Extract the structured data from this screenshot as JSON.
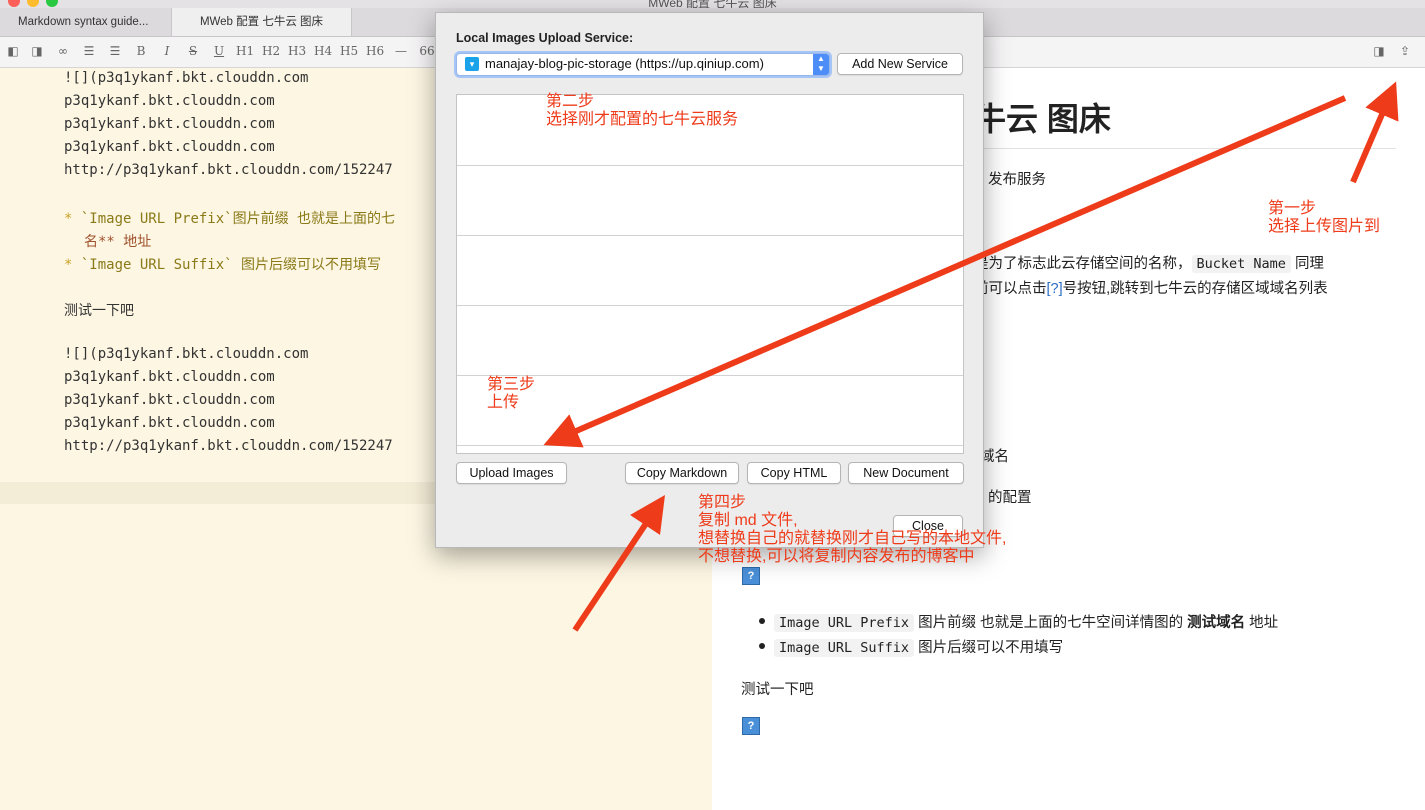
{
  "window": {
    "title": "MWeb 配置 七牛云 图床"
  },
  "tabs": [
    {
      "label": "Markdown syntax guide..."
    },
    {
      "label": "MWeb 配置 七牛云 图床"
    }
  ],
  "toolbar": {
    "items": [
      "B",
      "I",
      "S",
      "U",
      "H1",
      "H2",
      "H3",
      "H4",
      "H5",
      "H6",
      "—",
      "66"
    ]
  },
  "editor": {
    "lines": [
      "![](p3q1ykanf.bkt.clouddn.com",
      "p3q1ykanf.bkt.clouddn.com",
      "p3q1ykanf.bkt.clouddn.com",
      "p3q1ykanf.bkt.clouddn.com",
      "http://p3q1ykanf.bkt.clouddn.com/152247",
      "`Image URL Prefix`图片前缀 也就是上面的七",
      "名** 地址",
      "`Image URL Suffix` 图片后缀可以不用填写",
      "测试一下吧",
      "![](p3q1ykanf.bkt.clouddn.com",
      "p3q1ykanf.bkt.clouddn.com",
      "p3q1ykanf.bkt.clouddn.com",
      "p3q1ykanf.bkt.clouddn.com",
      "http://p3q1ykanf.bkt.clouddn.com/152247"
    ],
    "bullet_char": "*"
  },
  "preview": {
    "title_fragment": "牛云 图床",
    "line_publish": "发布服务",
    "line_bucket_a": "是为了标志此云存储空间的名称，",
    "bucket_code": "Bucket Name",
    "line_bucket_b": "同理",
    "line_link_a": "前可以点击",
    "link_text": "[?]",
    "line_link_b": "号按钮,跳转到七牛云的存储区域域名列表",
    "line_domain": "域名",
    "line_config": "的配置",
    "prefix_code": "Image URL Prefix",
    "prefix_text": "图片前缀 也就是上面的七牛空间详情图的",
    "prefix_bold": "测试域名",
    "prefix_tail": "地址",
    "suffix_code": "Image URL Suffix",
    "suffix_text": "图片后缀可以不用填写",
    "test_line": "测试一下吧",
    "q_icon": "?"
  },
  "dialog": {
    "label": "Local Images Upload Service:",
    "selected_service": "manajay-blog-pic-storage (https://up.qiniup.com)",
    "add_service": "Add New Service",
    "upload": "Upload Images",
    "copy_markdown": "Copy Markdown",
    "copy_html": "Copy HTML",
    "new_document": "New Document",
    "close": "Close"
  },
  "annotations": {
    "step1_a": "第一步",
    "step1_b": "选择上传图片到",
    "step2_a": "第二步",
    "step2_b": "选择刚才配置的七牛云服务",
    "step3_a": "第三步",
    "step3_b": "上传",
    "step4_a": "第四步",
    "step4_b": "复制 md 文件,",
    "step4_c": "想替换自己的就替换刚才自己写的本地文件,",
    "step4_d": "不想替换,可以将复制内容发布的博客中",
    "color": "#ee3b1a"
  }
}
